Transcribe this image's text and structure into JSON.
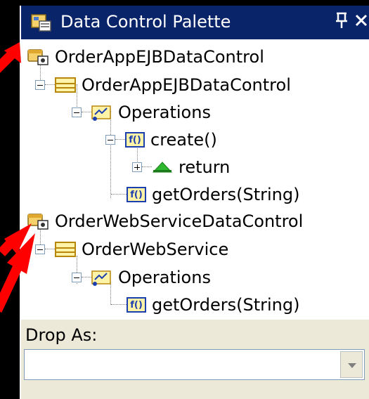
{
  "title": "Data Control Palette",
  "window_buttons": {
    "pin": "ꟼ",
    "close": "×"
  },
  "tree": {
    "ejb_root": "OrderAppEJBDataControl",
    "ejb_node": "OrderAppEJBDataControl",
    "ejb_ops": "Operations",
    "ejb_create": "create()",
    "ejb_return": "return",
    "ejb_getorders": "getOrders(String)",
    "ws_root": "OrderWebServiceDataControl",
    "ws_node": "OrderWebService",
    "ws_ops": "Operations",
    "ws_getorders": "getOrders(String)"
  },
  "drop_as": {
    "label": "Drop As:",
    "value": ""
  },
  "icons": {
    "data_control": "database-icon",
    "table": "structure-icon",
    "operations": "folder-icon",
    "method": "function-icon",
    "return": "triangle-icon"
  },
  "colors": {
    "titlebar": "#0A246A",
    "panel": "#ECE9D8",
    "annotation_arrow": "#FF0000"
  }
}
